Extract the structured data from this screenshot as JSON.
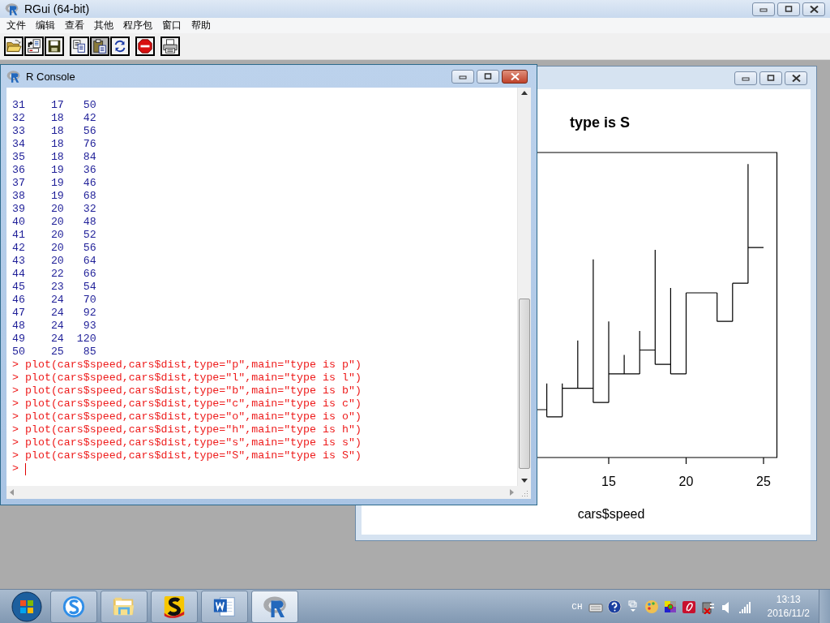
{
  "app_window": {
    "title": "RGui (64-bit)"
  },
  "menu": [
    "文件",
    "编辑",
    "查看",
    "其他",
    "程序包",
    "窗口",
    "帮助"
  ],
  "toolbar": [
    {
      "kind": "open",
      "pressed": false
    },
    {
      "kind": "load",
      "pressed": false
    },
    {
      "kind": "save",
      "pressed": false
    },
    {
      "kind": "copy",
      "pressed": false
    },
    {
      "kind": "paste",
      "pressed": true
    },
    {
      "kind": "refresh",
      "pressed": false
    },
    {
      "kind": "stop",
      "pressed": false
    },
    {
      "kind": "print",
      "pressed": false
    }
  ],
  "console": {
    "title": "R Console",
    "lines": [
      {
        "kind": "output",
        "text": "31    17   50"
      },
      {
        "kind": "output",
        "text": "32    18   42"
      },
      {
        "kind": "output",
        "text": "33    18   56"
      },
      {
        "kind": "output",
        "text": "34    18   76"
      },
      {
        "kind": "output",
        "text": "35    18   84"
      },
      {
        "kind": "output",
        "text": "36    19   36"
      },
      {
        "kind": "output",
        "text": "37    19   46"
      },
      {
        "kind": "output",
        "text": "38    19   68"
      },
      {
        "kind": "output",
        "text": "39    20   32"
      },
      {
        "kind": "output",
        "text": "40    20   48"
      },
      {
        "kind": "output",
        "text": "41    20   52"
      },
      {
        "kind": "output",
        "text": "42    20   56"
      },
      {
        "kind": "output",
        "text": "43    20   64"
      },
      {
        "kind": "output",
        "text": "44    22   66"
      },
      {
        "kind": "output",
        "text": "45    23   54"
      },
      {
        "kind": "output",
        "text": "46    24   70"
      },
      {
        "kind": "output",
        "text": "47    24   92"
      },
      {
        "kind": "output",
        "text": "48    24   93"
      },
      {
        "kind": "output",
        "text": "49    24  120"
      },
      {
        "kind": "output",
        "text": "50    25   85"
      },
      {
        "kind": "command",
        "text": "> plot(cars$speed,cars$dist,type=\"p\",main=\"type is p\")"
      },
      {
        "kind": "command",
        "text": "> plot(cars$speed,cars$dist,type=\"l\",main=\"type is l\")"
      },
      {
        "kind": "command",
        "text": "> plot(cars$speed,cars$dist,type=\"b\",main=\"type is b\")"
      },
      {
        "kind": "command",
        "text": "> plot(cars$speed,cars$dist,type=\"c\",main=\"type is c\")"
      },
      {
        "kind": "command",
        "text": "> plot(cars$speed,cars$dist,type=\"o\",main=\"type is o\")"
      },
      {
        "kind": "command",
        "text": "> plot(cars$speed,cars$dist,type=\"h\",main=\"type is h\")"
      },
      {
        "kind": "command",
        "text": "> plot(cars$speed,cars$dist,type=\"s\",main=\"type is s\")"
      },
      {
        "kind": "command",
        "text": "> plot(cars$speed,cars$dist,type=\"S\",main=\"type is S\")"
      },
      {
        "kind": "prompt",
        "text": ">"
      }
    ]
  },
  "graphics": {
    "plot": {
      "title": "type is S",
      "xticks": [
        "15",
        "20",
        "25"
      ],
      "xlabel": "cars$speed"
    }
  },
  "taskbar": {
    "apps": [
      {
        "kind": "sogou",
        "selected": false
      },
      {
        "kind": "explorer",
        "selected": false
      },
      {
        "kind": "s-app",
        "selected": false
      },
      {
        "kind": "word",
        "selected": false
      },
      {
        "kind": "r",
        "selected": true
      }
    ],
    "language": "CH",
    "tray": [
      {
        "kind": "keyboard"
      },
      {
        "kind": "help"
      },
      {
        "kind": "windows"
      },
      {
        "kind": "palette"
      },
      {
        "kind": "colors"
      },
      {
        "kind": "red-app"
      },
      {
        "kind": "power"
      },
      {
        "kind": "speaker"
      },
      {
        "kind": "signal"
      }
    ],
    "time": "13:13",
    "date": "2016/11/2"
  }
}
